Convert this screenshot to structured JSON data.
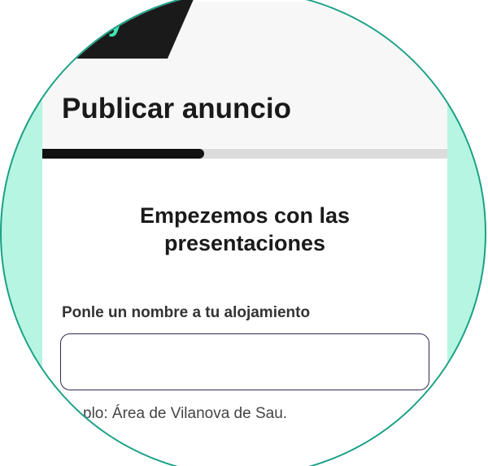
{
  "brand": {
    "text": "fly"
  },
  "header": {
    "title": "Publicar anuncio"
  },
  "progress": {
    "fraction": 0.4
  },
  "section": {
    "heading_line1": "Empezemos con las",
    "heading_line2": "presentaciones"
  },
  "name_field": {
    "label": "Ponle un nombre a tu alojamiento",
    "value": "",
    "placeholder": ""
  },
  "helper": {
    "text": "plo: Área de Vilanova de Sau."
  },
  "colors": {
    "accent": "#3ee6b2",
    "ring": "#1aa086",
    "mint_background": "#b6f5e2",
    "progress_fill": "#111111",
    "progress_track": "#dcdcdc"
  }
}
